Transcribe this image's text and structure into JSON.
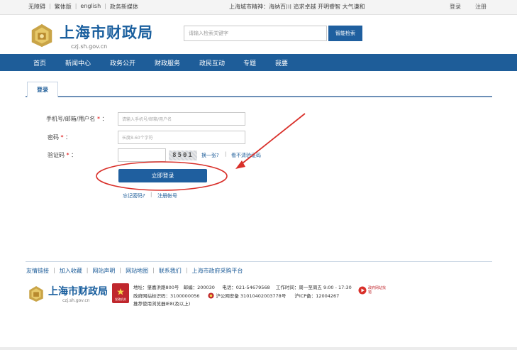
{
  "topbar": {
    "links": [
      "无障碍",
      "繁体版",
      "english",
      "政务新媒体"
    ],
    "spirit": "上海城市精神：海纳百川  追求卓越  开明睿智  大气谦和",
    "login": "登录",
    "register": "注册"
  },
  "header": {
    "title": "上海市财政局",
    "domain": "czj.sh.gov.cn",
    "search_placeholder": "请输入检索关键字",
    "search_button": "智能检索"
  },
  "nav": [
    "首页",
    "新闻中心",
    "政务公开",
    "财政服务",
    "政民互动",
    "专题",
    "我要"
  ],
  "login_panel": {
    "tab": "登录",
    "username_label": "手机号/邮箱/用户名",
    "username_placeholder": "请输入手机号/邮箱/用户名",
    "password_label": "密码",
    "password_placeholder": "长度8-60个字符",
    "captcha_label": "验证码",
    "captcha_text": "8501",
    "refresh_link": "换一张?",
    "unclear_link": "看不清验证码",
    "submit": "立即登录",
    "forgot": "忘记密码?",
    "register": "注册帐号",
    "required_mark": "*",
    "colon": "："
  },
  "footer": {
    "links": [
      "友情链接",
      "加入收藏",
      "网站声明",
      "网站地图",
      "联系我们",
      "上海市政府采购平台"
    ],
    "logo_title": "上海市财政局",
    "logo_domain": "czj.sh.gov.cn",
    "badge_text": "党政机关",
    "address": "地址：肇嘉浜路800号",
    "postcode": "邮编：200030",
    "phone": "电话：021-54679568",
    "hours": "工作时间：周一至周五 9:00 - 17:30",
    "site_code": "政府网站标识码：3100000056",
    "police": "沪公网安备 31010402003778号",
    "icp": "沪ICP备：12004267",
    "browser": "推荐使用浏览器IE8(及以上)",
    "error_badge": "政府网站找错"
  },
  "colors": {
    "brand": "#1e5d99",
    "annotation": "#d9302a"
  }
}
